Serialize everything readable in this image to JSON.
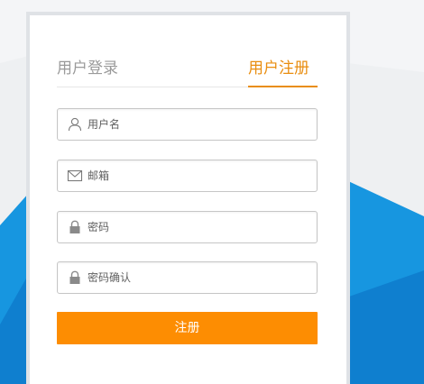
{
  "tabs": {
    "login_label": "用户登录",
    "register_label": "用户注册",
    "active": "register"
  },
  "fields": {
    "username": {
      "placeholder": "用户名",
      "icon": "user-icon"
    },
    "email": {
      "placeholder": "邮箱",
      "icon": "envelope-icon"
    },
    "password": {
      "placeholder": "密码",
      "icon": "lock-icon"
    },
    "confirm_password": {
      "placeholder": "密码确认",
      "icon": "lock-icon"
    }
  },
  "submit": {
    "label": "注册"
  },
  "colors": {
    "accent": "#fd8d02",
    "active_tab": "#e98d0f",
    "background_shape": "#1796e0",
    "background_shape_dark": "#0f7fcf"
  }
}
